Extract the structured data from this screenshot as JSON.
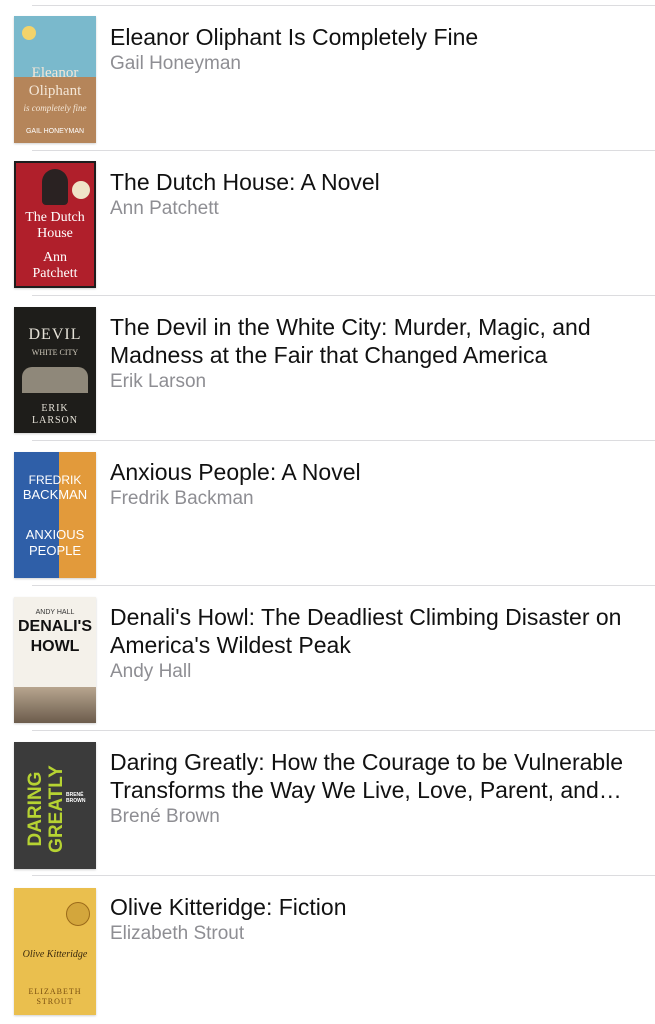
{
  "books": [
    {
      "title": "Eleanor Oliphant Is Completely Fine",
      "author": "Gail Honeyman",
      "cover": {
        "text": [
          "Eleanor",
          "Oliphant",
          "is completely fine",
          "GAIL HONEYMAN"
        ],
        "bg": "#7ab9cc",
        "accent": "#b5855a"
      }
    },
    {
      "title": "The Dutch House: A Novel",
      "author": "Ann Patchett",
      "cover": {
        "text": [
          "The Dutch",
          "House",
          "Ann",
          "Patchett"
        ],
        "bg": "#b01f2b",
        "accent": "#2d3a5c"
      }
    },
    {
      "title": "The Devil in the White City: Murder, Magic, and Madness at the Fair that Changed America",
      "author": "Erik Larson",
      "cover": {
        "text": [
          "DEVIL",
          "WHITE CITY",
          "ERIK",
          "LARSON"
        ],
        "bg": "#1e1d1a",
        "accent": "#8f887a"
      }
    },
    {
      "title": "Anxious People: A Novel",
      "author": "Fredrik Backman",
      "cover": {
        "text": [
          "FREDRIK",
          "BACKMAN",
          "ANXIOUS",
          "PEOPLE"
        ],
        "bg": "#2f5fa8",
        "accent": "#e29a3b"
      }
    },
    {
      "title": "Denali's Howl: The Deadliest Climbing Disaster on America's Wildest Peak",
      "author": "Andy Hall",
      "cover": {
        "text": [
          "ANDY HALL",
          "DENALI'S",
          "HOWL"
        ],
        "bg": "#f4f1ea",
        "accent": "#6c5c4c"
      }
    },
    {
      "title": "Daring Greatly: How the Courage to be Vulnerable Transforms the Way We Live, Love, Parent, and Lead",
      "author": "Brené Brown",
      "cover": {
        "text": [
          "DARING",
          "GREATLY",
          "BRENÉ BROWN"
        ],
        "bg": "#3b3b3b",
        "accent": "#b6d332"
      }
    },
    {
      "title": "Olive Kitteridge: Fiction",
      "author": "Elizabeth Strout",
      "cover": {
        "text": [
          "Olive Kitteridge",
          "ELIZABETH",
          "STROUT"
        ],
        "bg": "#eabf4e",
        "accent": "#9b6a1a"
      }
    }
  ]
}
